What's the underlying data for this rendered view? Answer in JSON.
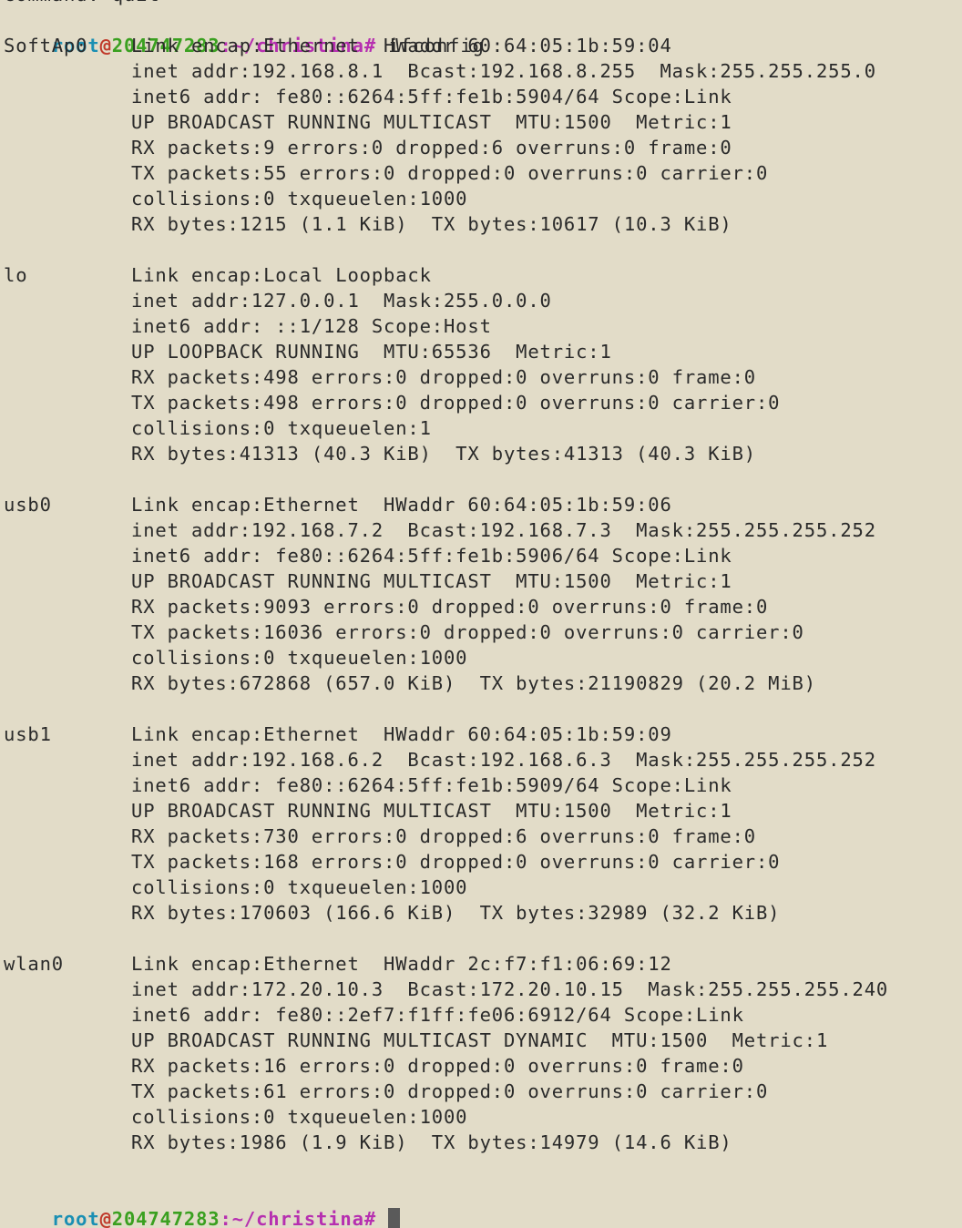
{
  "terminal": {
    "top_clipped_line": "command: quit",
    "prompt": {
      "user": "root",
      "at": "@",
      "host": "204747283",
      "path": ":~/christina",
      "symbol": "# "
    },
    "command": "ifconfig",
    "interfaces": [
      {
        "name": "SoftAp0",
        "lines": [
          "Link encap:Ethernet  HWaddr 60:64:05:1b:59:04",
          "inet addr:192.168.8.1  Bcast:192.168.8.255  Mask:255.255.255.0",
          "inet6 addr: fe80::6264:5ff:fe1b:5904/64 Scope:Link",
          "UP BROADCAST RUNNING MULTICAST  MTU:1500  Metric:1",
          "RX packets:9 errors:0 dropped:6 overruns:0 frame:0",
          "TX packets:55 errors:0 dropped:0 overruns:0 carrier:0",
          "collisions:0 txqueuelen:1000",
          "RX bytes:1215 (1.1 KiB)  TX bytes:10617 (10.3 KiB)"
        ]
      },
      {
        "name": "lo",
        "lines": [
          "Link encap:Local Loopback",
          "inet addr:127.0.0.1  Mask:255.0.0.0",
          "inet6 addr: ::1/128 Scope:Host",
          "UP LOOPBACK RUNNING  MTU:65536  Metric:1",
          "RX packets:498 errors:0 dropped:0 overruns:0 frame:0",
          "TX packets:498 errors:0 dropped:0 overruns:0 carrier:0",
          "collisions:0 txqueuelen:1",
          "RX bytes:41313 (40.3 KiB)  TX bytes:41313 (40.3 KiB)"
        ]
      },
      {
        "name": "usb0",
        "lines": [
          "Link encap:Ethernet  HWaddr 60:64:05:1b:59:06",
          "inet addr:192.168.7.2  Bcast:192.168.7.3  Mask:255.255.255.252",
          "inet6 addr: fe80::6264:5ff:fe1b:5906/64 Scope:Link",
          "UP BROADCAST RUNNING MULTICAST  MTU:1500  Metric:1",
          "RX packets:9093 errors:0 dropped:0 overruns:0 frame:0",
          "TX packets:16036 errors:0 dropped:0 overruns:0 carrier:0",
          "collisions:0 txqueuelen:1000",
          "RX bytes:672868 (657.0 KiB)  TX bytes:21190829 (20.2 MiB)"
        ]
      },
      {
        "name": "usb1",
        "lines": [
          "Link encap:Ethernet  HWaddr 60:64:05:1b:59:09",
          "inet addr:192.168.6.2  Bcast:192.168.6.3  Mask:255.255.255.252",
          "inet6 addr: fe80::6264:5ff:fe1b:5909/64 Scope:Link",
          "UP BROADCAST RUNNING MULTICAST  MTU:1500  Metric:1",
          "RX packets:730 errors:0 dropped:6 overruns:0 frame:0",
          "TX packets:168 errors:0 dropped:0 overruns:0 carrier:0",
          "collisions:0 txqueuelen:1000",
          "RX bytes:170603 (166.6 KiB)  TX bytes:32989 (32.2 KiB)"
        ]
      },
      {
        "name": "wlan0",
        "lines": [
          "Link encap:Ethernet  HWaddr 2c:f7:f1:06:69:12",
          "inet addr:172.20.10.3  Bcast:172.20.10.15  Mask:255.255.255.240",
          "inet6 addr: fe80::2ef7:f1ff:fe06:6912/64 Scope:Link",
          "UP BROADCAST RUNNING MULTICAST DYNAMIC  MTU:1500  Metric:1",
          "RX packets:16 errors:0 dropped:0 overruns:0 frame:0",
          "TX packets:61 errors:0 dropped:0 overruns:0 carrier:0",
          "collisions:0 txqueuelen:1000",
          "RX bytes:1986 (1.9 KiB)  TX bytes:14979 (14.6 KiB)"
        ]
      }
    ],
    "colors": {
      "background": "#e2dcc8",
      "text": "#2a2a2a",
      "prompt_user": "#1a8fb3",
      "prompt_at": "#c03a2b",
      "prompt_host": "#3aa020",
      "prompt_path": "#b62fb0",
      "cursor": "#5a5a5a"
    }
  }
}
